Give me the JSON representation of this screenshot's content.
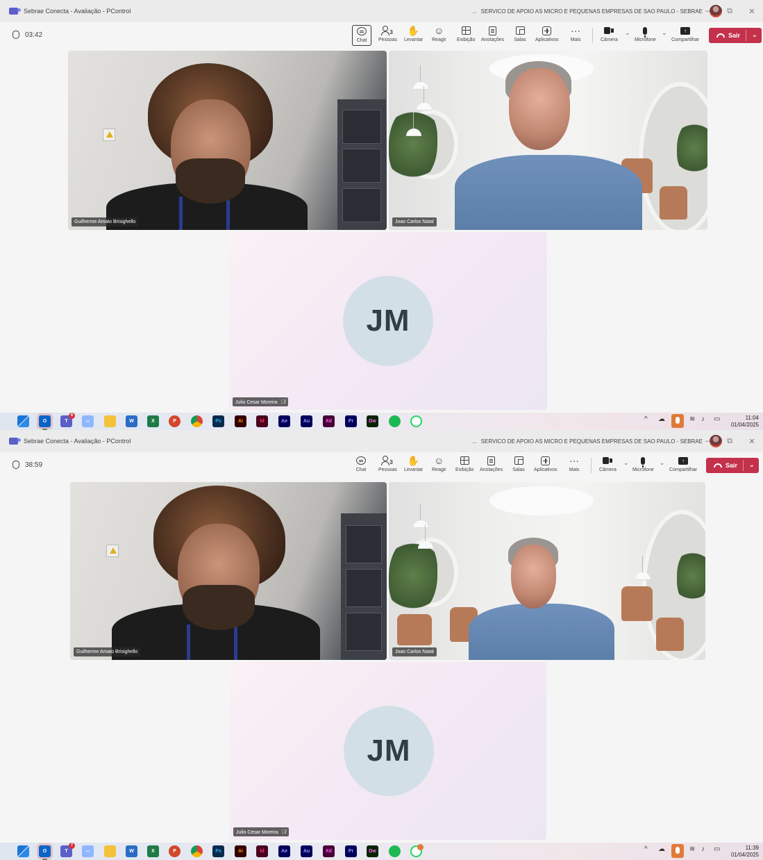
{
  "screens": [
    {
      "window_title": "Sebrae Conecta - Avaliação - PControl",
      "more_label": "...",
      "org_name": "SERVICO DE APOIO AS MICRO E PEQUENAS EMPRESAS DE SAO PAULO - SEBRAE",
      "timer": "03:42",
      "people_count": "3",
      "participants": [
        "Guilherme Amato Brisighello",
        "Joao Carlos Natal",
        "Julio Cesar Moreira"
      ],
      "avatar_initials": "JM",
      "clock_time": "11:04",
      "clock_date": "01/04/2025",
      "teams_badge": "6"
    },
    {
      "window_title": "Sebrae Conecta - Avaliação - PControl",
      "more_label": "...",
      "org_name": "SERVICO DE APOIO AS MICRO E PEQUENAS EMPRESAS DE SAO PAULO - SEBRAE",
      "timer": "38:59",
      "people_count": "3",
      "participants": [
        "Guilherme Amato Brisighello",
        "Joao Carlos Natal",
        "Julio Cesar Moreira"
      ],
      "avatar_initials": "JM",
      "clock_time": "11:39",
      "clock_date": "01/04/2025",
      "teams_badge": "7"
    }
  ],
  "toolbar": {
    "chat": "Chat",
    "people": "Pessoas",
    "raise": "Levantar",
    "react": "Reagir",
    "view": "Exibição",
    "notes": "Anotações",
    "rooms": "Salas",
    "apps": "Aplicativos",
    "more": "Mais",
    "camera": "Câmera",
    "mic": "Microfone",
    "share": "Compartilhar",
    "leave": "Sair"
  },
  "taskbar_labels": {
    "ps": "Ps",
    "ai": "Ai",
    "id": "Id",
    "ae": "Ae",
    "au": "Au",
    "xd": "Xd",
    "pr": "Pr",
    "dw": "Dw"
  },
  "colors": {
    "leave": "#c4314b",
    "teams": "#5b5fc7"
  }
}
